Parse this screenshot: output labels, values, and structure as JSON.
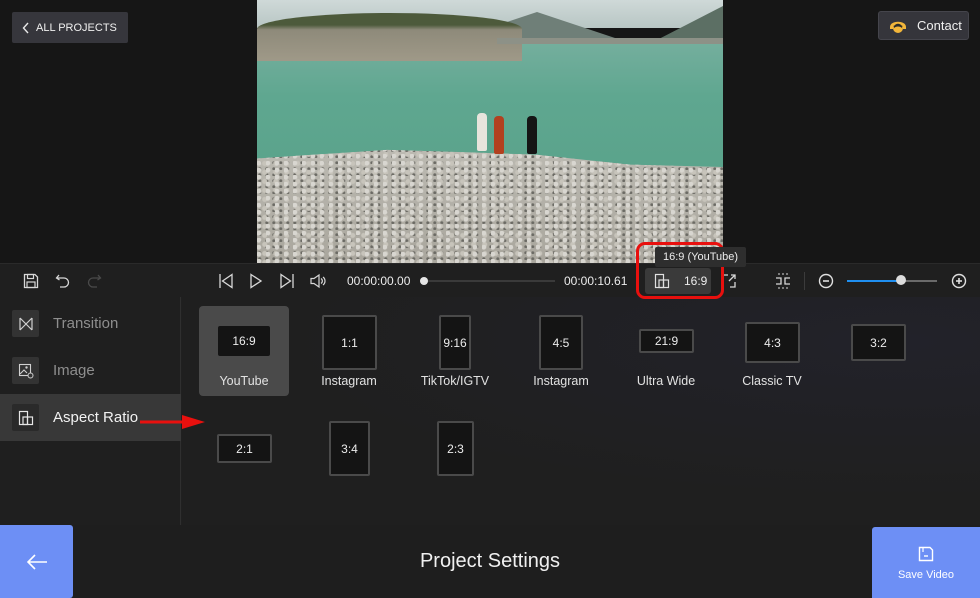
{
  "header": {
    "all_projects_label": "ALL PROJECTS",
    "contact_label": "Contact"
  },
  "player": {
    "current_time": "00:00:00.00",
    "total_time": "00:00:10.61",
    "progress": 0.0,
    "aspect_button_label": "16:9",
    "aspect_tooltip": "16:9 (YouTube)",
    "zoom_level": 0.6
  },
  "sidebar": {
    "items": [
      {
        "label": "Transition",
        "icon": "transition-icon",
        "active": false
      },
      {
        "label": "Image",
        "icon": "image-icon",
        "active": false
      },
      {
        "label": "Aspect Ratio",
        "icon": "aspect-ratio-icon",
        "active": true
      }
    ]
  },
  "ratios": [
    {
      "ratio": "16:9",
      "label": "YouTube",
      "selected": true
    },
    {
      "ratio": "1:1",
      "label": "Instagram",
      "selected": false
    },
    {
      "ratio": "9:16",
      "label": "TikTok/IGTV",
      "selected": false
    },
    {
      "ratio": "4:5",
      "label": "Instagram",
      "selected": false
    },
    {
      "ratio": "21:9",
      "label": "Ultra Wide",
      "selected": false
    },
    {
      "ratio": "4:3",
      "label": "Classic TV",
      "selected": false
    },
    {
      "ratio": "3:2",
      "label": "",
      "selected": false
    },
    {
      "ratio": "2:1",
      "label": "",
      "selected": false
    },
    {
      "ratio": "3:4",
      "label": "",
      "selected": false
    },
    {
      "ratio": "2:3",
      "label": "",
      "selected": false
    }
  ],
  "footer": {
    "title": "Project Settings",
    "save_label": "Save Video"
  },
  "colors": {
    "accent": "#6d8ff5",
    "annotation_red": "#e8100e",
    "slider_blue": "#1f8ff0",
    "contact_avatar": "#f2b63a"
  }
}
